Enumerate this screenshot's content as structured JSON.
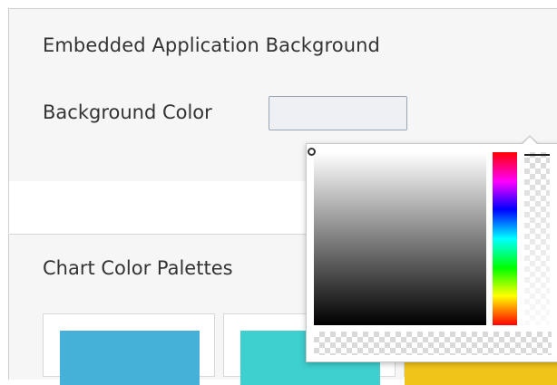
{
  "embedded_background": {
    "section_title": "Embedded Application Background",
    "field_label": "Background Color",
    "color_value": "#eef0f3"
  },
  "chart_palettes": {
    "section_title": "Chart Color Palettes",
    "palettes": [
      {
        "color": "#45b0d8"
      },
      {
        "color": "#3ecfcf"
      },
      {
        "color": "#f0c419"
      }
    ]
  },
  "color_picker": {
    "hue_color": "#ff0000",
    "alpha_handle_position": "top"
  }
}
